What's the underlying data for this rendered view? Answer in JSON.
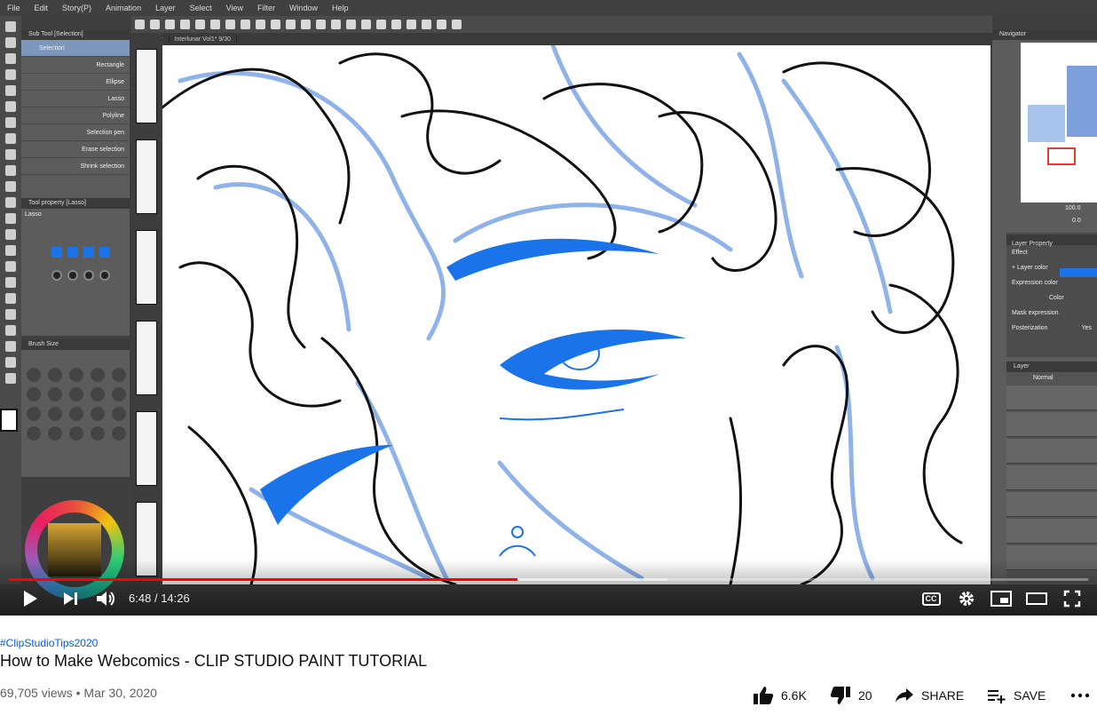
{
  "app": {
    "menu": [
      "File",
      "Edit",
      "Story(P)",
      "Animation",
      "Layer",
      "Select",
      "View",
      "Filter",
      "Window",
      "Help"
    ],
    "tabs": [
      "Interlunar",
      "Interlunar Vol1* 9/30"
    ],
    "subtool_panel": {
      "title": "Sub Tool [Selection]",
      "group": "Selection",
      "items": [
        "Rectangle",
        "Ellipse",
        "Lasso",
        "Polyline",
        "Selection pen",
        "Erase selection",
        "Shrink selection"
      ]
    },
    "tool_property": {
      "title": "Tool property [Lasso]",
      "tool": "Lasso"
    },
    "brush_size_title": "Brush Size",
    "navigator_title": "Navigator",
    "navigator_zoom": "100.0",
    "navigator_angle": "0.0",
    "layer_property": {
      "title": "Layer Property",
      "effect": "Effect",
      "layer_color": "+ Layer color",
      "expression_color": "Expression color",
      "color_value": "Color",
      "mask_expression": "Mask expression",
      "posterization": "Posterization",
      "posterization_value": "Yes"
    },
    "layer_panel": {
      "title": "Layer",
      "blend_mode": "Normal"
    }
  },
  "player": {
    "current_time": "6:48",
    "duration": "14:26",
    "time_separator": "/",
    "progress_fraction": 0.471,
    "buffered_fraction": 0.61,
    "controls": [
      "play-icon",
      "next-icon",
      "volume-icon",
      "captions-icon",
      "settings-icon",
      "miniplayer-icon",
      "theater-icon",
      "fullscreen-icon"
    ],
    "cc_label": "CC"
  },
  "video": {
    "hashtag": "#ClipStudioTips2020",
    "title": "How to Make Webcomics - CLIP STUDIO PAINT TUTORIAL",
    "views": "69,705 views",
    "separator": "•",
    "date": "Mar 30, 2020"
  },
  "actions": {
    "likes": "6.6K",
    "dislikes": "20",
    "share": "SHARE",
    "save": "SAVE"
  },
  "colors": {
    "progress_red": "#ff0000",
    "hashtag_blue": "#065fd4",
    "sketch_blue": "#8fb3e8",
    "ink_blue": "#1a73e8"
  }
}
